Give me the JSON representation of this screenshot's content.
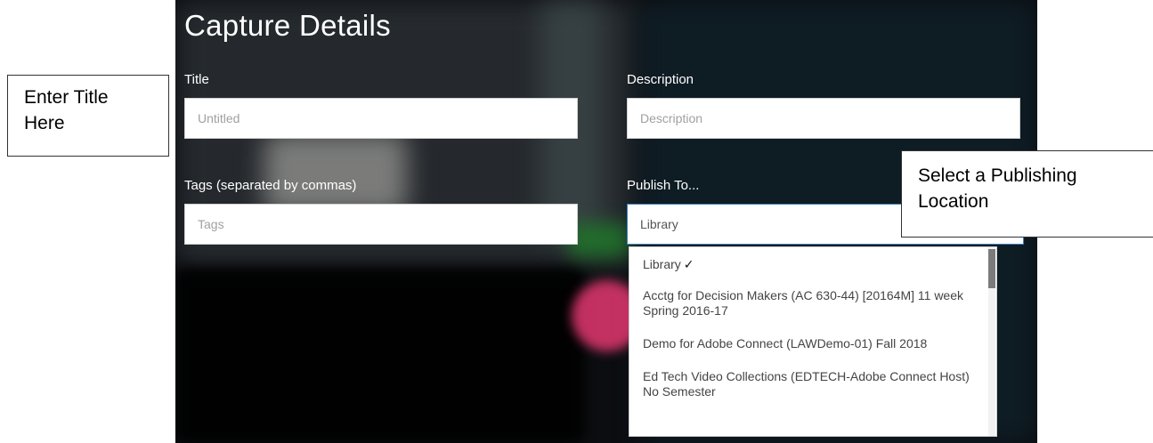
{
  "panel": {
    "title": "Capture Details"
  },
  "fields": {
    "title": {
      "label": "Title",
      "placeholder": "Untitled"
    },
    "description": {
      "label": "Description",
      "placeholder": "Description"
    },
    "tags": {
      "label": "Tags (separated by commas)",
      "placeholder": "Tags"
    },
    "publish_to": {
      "label": "Publish To...",
      "selected": "Library",
      "options": [
        {
          "label": "Library",
          "checked": "✓"
        },
        {
          "label": "Acctg for Decision Makers (AC 630-44) [20164M] 11 week Spring 2016-17"
        },
        {
          "label": "Demo for Adobe Connect (LAWDemo-01) Fall 2018"
        },
        {
          "label": "Ed Tech Video Collections (EDTECH-Adobe Connect Host) No Semester"
        }
      ]
    }
  },
  "callouts": {
    "title_note": {
      "line1": "Enter Title",
      "line2": "Here"
    },
    "publish_note": {
      "line1": "Select a Publishing",
      "line2": "Location"
    }
  },
  "colors": {
    "panel_background": "#0b0d10",
    "select_focus_border": "#3a7fc1",
    "scrollbar_thumb": "#7b7b7b"
  }
}
